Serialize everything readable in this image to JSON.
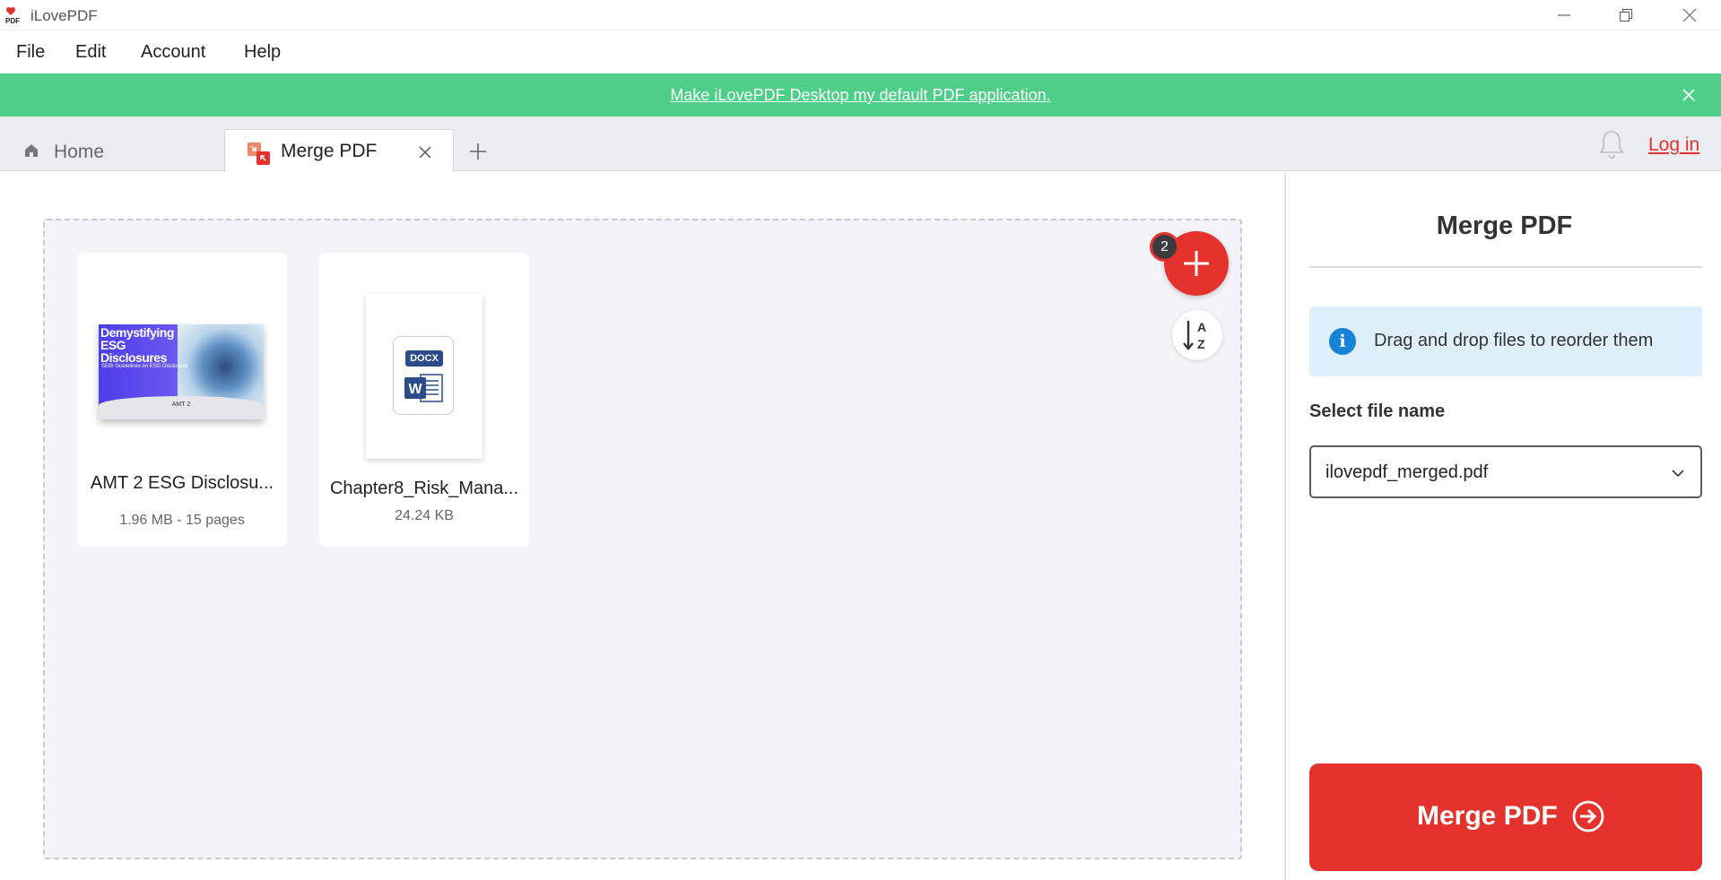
{
  "window": {
    "title": "iLovePDF",
    "logo_text": "PDF",
    "controls": [
      "minimize-icon",
      "restore-icon",
      "close-icon"
    ]
  },
  "menu": {
    "items": [
      "File",
      "Edit",
      "Account",
      "Help"
    ]
  },
  "banner": {
    "text": "Make iLovePDF Desktop my default PDF application.",
    "color": "#4dcf87"
  },
  "tabs": {
    "home_label": "Home",
    "active_label": "Merge PDF",
    "login_label": "Log in"
  },
  "files": [
    {
      "name": "AMT 2 ESG Disclosu...",
      "meta": "1.96 MB - 15 pages",
      "thumbnail": {
        "title": "Demystifying ESG Disclosures",
        "subtitle": "SEBI Guidelines on ESG Disclosure",
        "footer": "AMT 2"
      }
    },
    {
      "name": "Chapter8_Risk_Mana...",
      "meta": "24.24 KB",
      "thumbnail": {
        "badge": "DOCX",
        "letter": "W"
      }
    }
  ],
  "controls": {
    "file_count": "2",
    "sort_icon": "sort-az-icon",
    "add_icon": "plus-icon"
  },
  "sidebar": {
    "title": "Merge PDF",
    "info_text": "Drag and drop files to reorder them",
    "select_label": "Select file name",
    "select_value": "ilovepdf_merged.pdf",
    "merge_button": "Merge PDF"
  },
  "colors": {
    "accent": "#e5322d",
    "info_bg": "#def0fb",
    "info_icon": "#1683d8",
    "word_blue": "#2b4c8a"
  }
}
